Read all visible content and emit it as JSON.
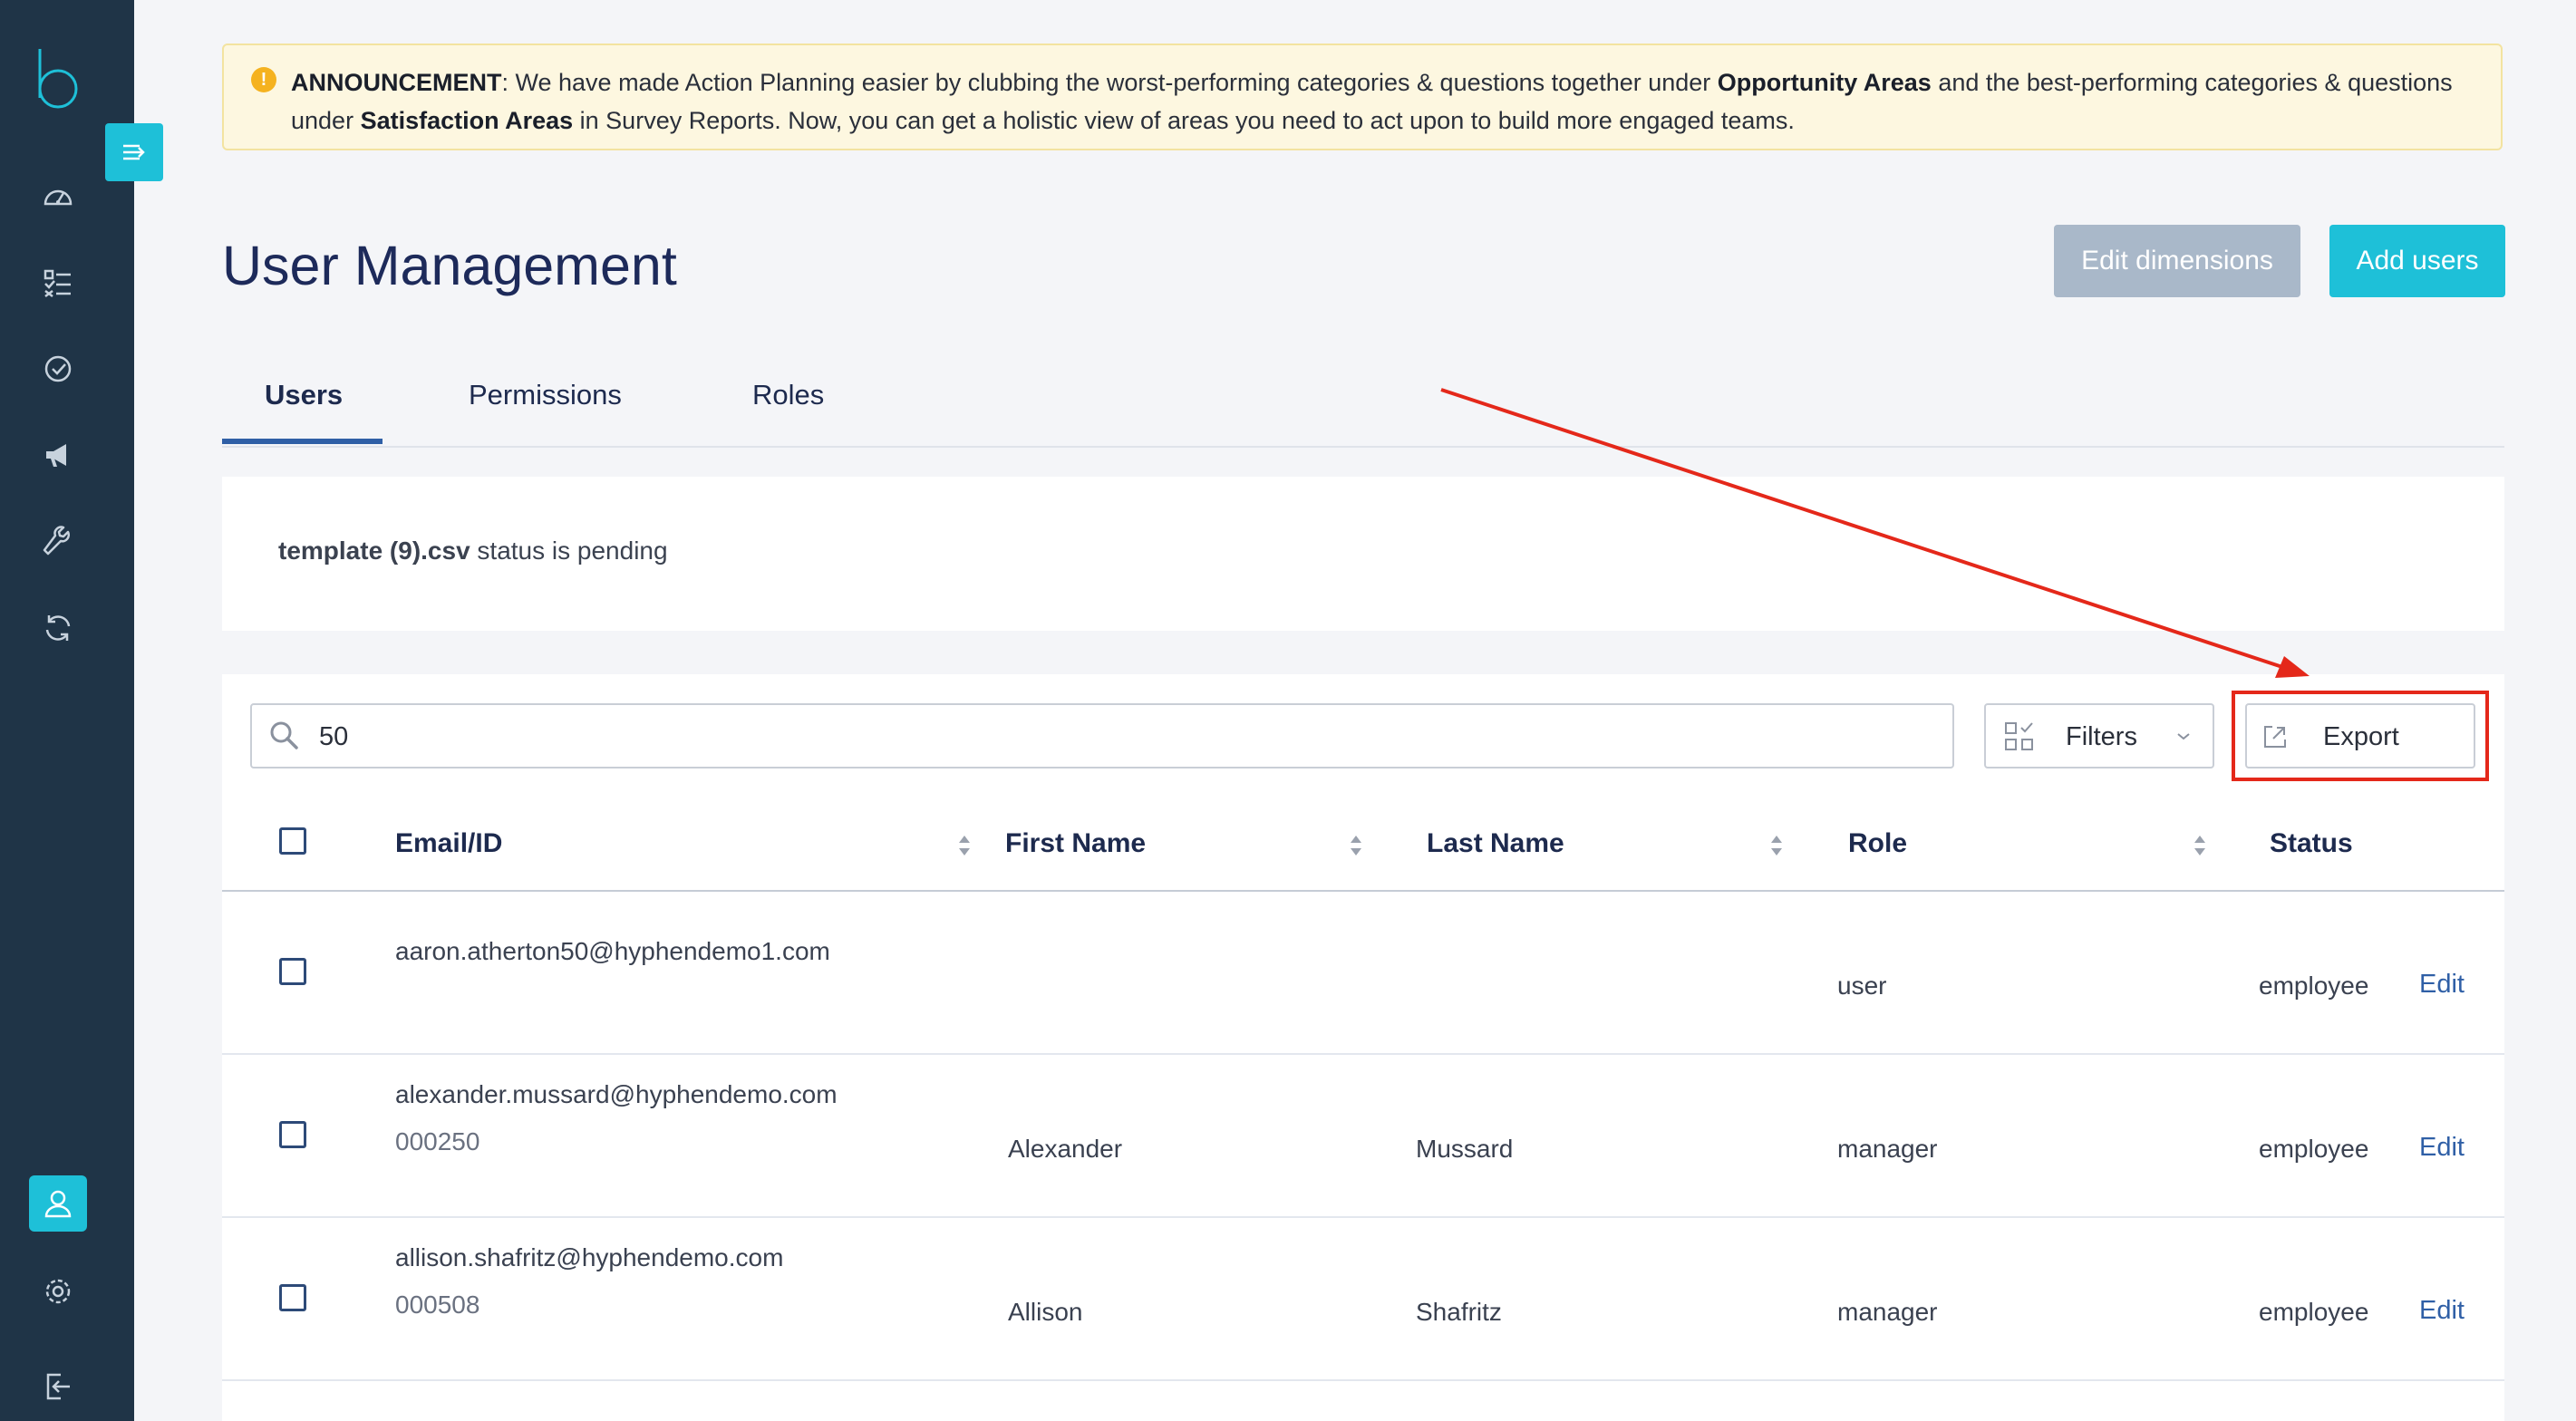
{
  "sidebar": {
    "logo_letter": "b",
    "items": [
      {
        "icon": "dashboard-icon"
      },
      {
        "icon": "checklist-icon"
      },
      {
        "icon": "check-circle-icon"
      },
      {
        "icon": "megaphone-icon"
      },
      {
        "icon": "wrench-icon"
      },
      {
        "icon": "sync-icon"
      },
      {
        "icon": "user-icon",
        "active": true
      },
      {
        "icon": "gear-icon"
      },
      {
        "icon": "logout-icon"
      }
    ]
  },
  "announcement": {
    "label": "ANNOUNCEMENT",
    "text_1": ": We have made Action Planning easier by clubbing the worst-performing categories & questions  together under ",
    "bold_1": "Opportunity Areas",
    "text_2": " and the best-performing  categories & questions under ",
    "bold_2": "Satisfaction Areas",
    "text_3": " in Survey Reports.  Now, you can get a holistic view of areas you need to act upon to build more engaged teams."
  },
  "page_title": "User Management",
  "buttons": {
    "edit_dimensions": "Edit dimensions",
    "add_users": "Add users"
  },
  "tabs": [
    {
      "label": "Users",
      "active": true
    },
    {
      "label": "Permissions"
    },
    {
      "label": "Roles"
    }
  ],
  "upload_status": {
    "filename": "template (9).csv",
    "message": " status is pending"
  },
  "toolbar": {
    "search_value": "50",
    "filters_label": "Filters",
    "export_label": "Export"
  },
  "table": {
    "columns": [
      "Email/ID",
      "First Name",
      "Last Name",
      "Role",
      "Status"
    ],
    "rows": [
      {
        "email": "aaron.atherton50@hyphendemo1.com",
        "id": "",
        "first_name": "",
        "last_name": "",
        "role": "user",
        "status": "employee",
        "action": "Edit"
      },
      {
        "email": "alexander.mussard@hyphendemo.com",
        "id": "000250",
        "first_name": "Alexander",
        "last_name": "Mussard",
        "role": "manager",
        "status": "employee",
        "action": "Edit"
      },
      {
        "email": "allison.shafritz@hyphendemo.com",
        "id": "000508",
        "first_name": "Allison",
        "last_name": "Shafritz",
        "role": "manager",
        "status": "employee",
        "action": "Edit"
      }
    ]
  },
  "colors": {
    "sidebar_bg": "#1f3447",
    "accent": "#1ec0d8",
    "annotation_red": "#e4281a",
    "link_blue": "#2f5fa6"
  }
}
